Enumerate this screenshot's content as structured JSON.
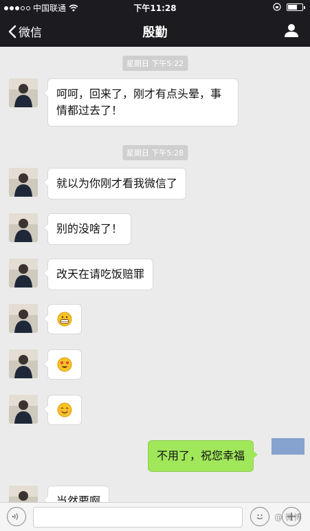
{
  "status_bar": {
    "carrier": "中国联通",
    "time": "下午11:28"
  },
  "nav": {
    "back_label": "微信",
    "title": "殷勤"
  },
  "messages": [
    {
      "type": "time",
      "text": "星期日 下午5:22"
    },
    {
      "type": "left",
      "text_lines": [
        "呵呵，回来了，刚才有点头晕，事",
        "情都过去了！"
      ]
    },
    {
      "type": "time",
      "text": "星期日 下午5:28"
    },
    {
      "type": "left",
      "text": "就以为你刚才看我微信了"
    },
    {
      "type": "left",
      "text": "别的没啥了！"
    },
    {
      "type": "left",
      "text": "改天在请吃饭赔罪"
    },
    {
      "type": "left",
      "emoji": "grin-emoji"
    },
    {
      "type": "left",
      "emoji": "heart-eyes-emoji"
    },
    {
      "type": "left",
      "emoji": "smile-emoji"
    },
    {
      "type": "right",
      "text": "不用了，祝您幸福"
    },
    {
      "type": "left",
      "text": "当然要啊"
    }
  ],
  "input": {
    "placeholder": ""
  },
  "watermark": "@ 微博"
}
